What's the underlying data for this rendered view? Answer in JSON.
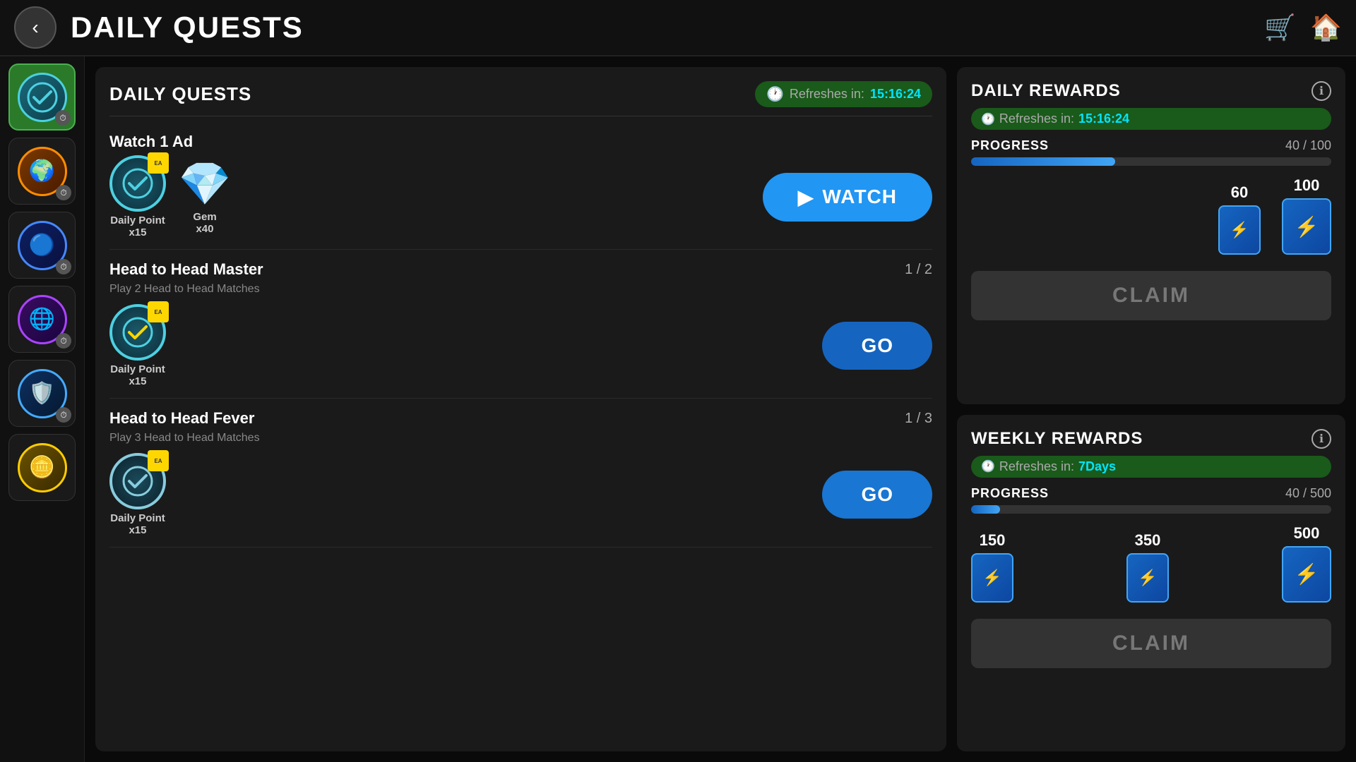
{
  "header": {
    "title": "DAILY QUESTS",
    "back_label": "‹",
    "cart_icon": "🛒",
    "home_icon": "🏠"
  },
  "sidebar": {
    "items": [
      {
        "id": "quests",
        "icon": "✓",
        "active": true,
        "badge": "⏱"
      },
      {
        "id": "orange",
        "active": false,
        "badge": "⏱"
      },
      {
        "id": "blue",
        "active": false,
        "badge": "⏱"
      },
      {
        "id": "purple",
        "active": false,
        "badge": "⏱"
      },
      {
        "id": "shield",
        "active": false,
        "badge": "⏱"
      },
      {
        "id": "coin",
        "active": false,
        "badge": ""
      }
    ]
  },
  "quests_panel": {
    "title": "DAILY QUESTS",
    "refresh_label": "Refreshes in:",
    "refresh_time": "15:16:24",
    "quests": [
      {
        "id": "watch-ad",
        "name": "Watch 1 Ad",
        "progress": "",
        "description": "",
        "rewards": [
          {
            "type": "daily-point",
            "label": "Daily Point",
            "amount": "x15"
          },
          {
            "type": "gem",
            "label": "Gem",
            "amount": "x40"
          }
        ],
        "action": "WATCH",
        "action_type": "watch"
      },
      {
        "id": "head-to-head-master",
        "name": "Head to Head Master",
        "progress": "1 / 2",
        "description": "Play 2 Head to Head Matches",
        "rewards": [
          {
            "type": "daily-point",
            "label": "Daily Point",
            "amount": "x15"
          }
        ],
        "action": "GO",
        "action_type": "go"
      },
      {
        "id": "head-to-head-fever",
        "name": "Head to Head Fever",
        "progress": "1 / 3",
        "description": "Play 3 Head to Head Matches",
        "rewards": [
          {
            "type": "daily-point",
            "label": "Daily Point",
            "amount": "x15"
          }
        ],
        "action": "GO",
        "action_type": "go"
      }
    ]
  },
  "daily_rewards": {
    "title": "DAILY REWARDS",
    "info_icon": "ℹ",
    "refresh_label": "Refreshes in:",
    "refresh_time": "15:16:24",
    "progress_label": "PROGRESS",
    "progress_current": 40,
    "progress_max": 100,
    "progress_display": "40 / 100",
    "progress_pct": 40,
    "milestones": [
      {
        "value": "60",
        "icon": "pack"
      },
      {
        "value": "100",
        "icon": "pack"
      }
    ],
    "claim_label": "CLAIM",
    "claim_active": false
  },
  "weekly_rewards": {
    "title": "WEEKLY REWARDS",
    "info_icon": "ℹ",
    "refresh_label": "Refreshes in:",
    "refresh_time": "7Days",
    "progress_label": "PROGRESS",
    "progress_current": 40,
    "progress_max": 500,
    "progress_display": "40 / 500",
    "progress_pct": 8,
    "milestones": [
      {
        "value": "150",
        "icon": "pack"
      },
      {
        "value": "350",
        "icon": "pack"
      },
      {
        "value": "500",
        "icon": "pack"
      }
    ],
    "claim_label": "CLAIM",
    "claim_active": false
  }
}
